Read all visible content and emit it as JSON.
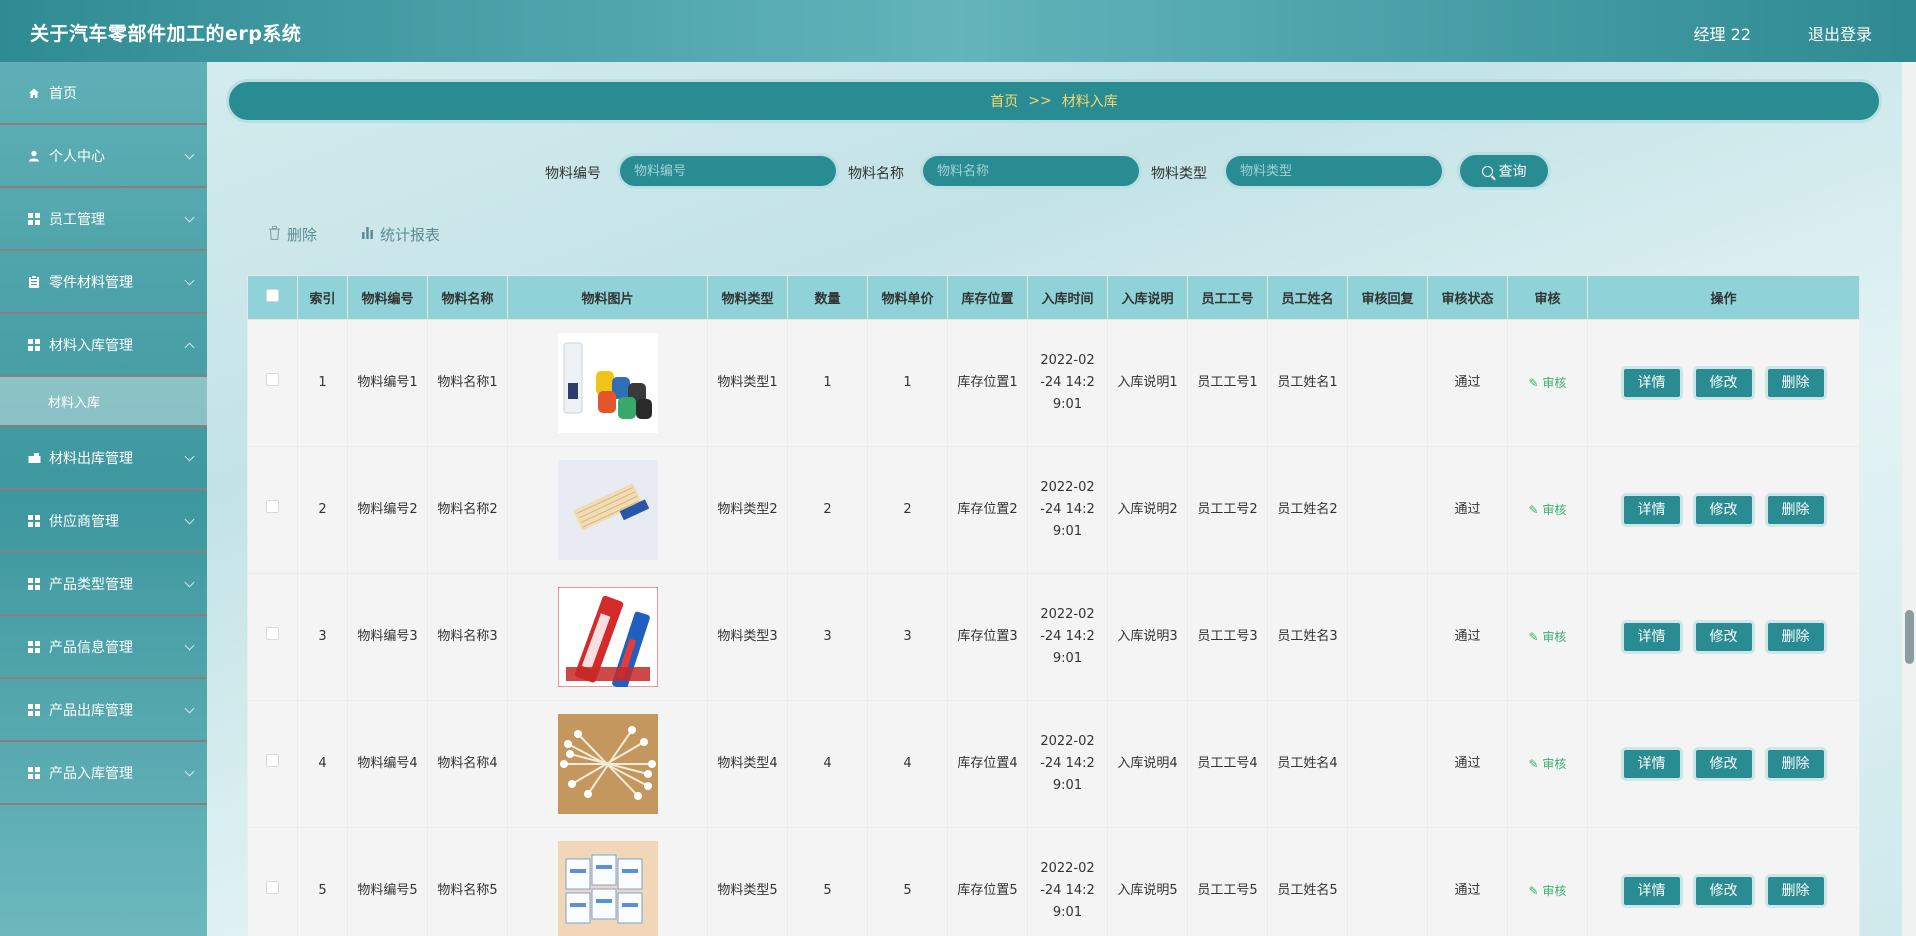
{
  "app": {
    "title": "关于汽车零部件加工的erp系统",
    "user": "经理 22",
    "logout": "退出登录"
  },
  "sidebar": {
    "items": [
      {
        "label": "首页",
        "icon": "home-icon"
      },
      {
        "label": "个人中心",
        "icon": "user-icon"
      },
      {
        "label": "员工管理",
        "icon": "grid-icon"
      },
      {
        "label": "零件材料管理",
        "icon": "clipboard-icon"
      },
      {
        "label": "材料入库管理",
        "icon": "grid-icon"
      },
      {
        "label": "材料出库管理",
        "icon": "truck-icon"
      },
      {
        "label": "供应商管理",
        "icon": "grid-icon"
      },
      {
        "label": "产品类型管理",
        "icon": "grid-icon"
      },
      {
        "label": "产品信息管理",
        "icon": "grid-icon"
      },
      {
        "label": "产品出库管理",
        "icon": "grid-icon"
      },
      {
        "label": "产品入库管理",
        "icon": "grid-icon"
      }
    ],
    "active_sub": "材料入库"
  },
  "breadcrumb": {
    "home": "首页",
    "sep": ">>",
    "current": "材料入库"
  },
  "search": {
    "code_label": "物料编号",
    "code_placeholder": "物料编号",
    "name_label": "物料名称",
    "name_placeholder": "物料名称",
    "type_label": "物料类型",
    "type_placeholder": "物料类型",
    "button": "查询"
  },
  "actions": {
    "delete": "删除",
    "report": "统计报表"
  },
  "table": {
    "headers": [
      "索引",
      "物料编号",
      "物料名称",
      "物料图片",
      "物料类型",
      "数量",
      "物料单价",
      "库存位置",
      "入库时间",
      "入库说明",
      "员工工号",
      "员工姓名",
      "审核回复",
      "审核状态",
      "审核",
      "操作"
    ],
    "rows": [
      {
        "index": "1",
        "code": "物料编号1",
        "name": "物料名称1",
        "type": "物料类型1",
        "qty": "1",
        "price": "1",
        "location": "库存位置1",
        "time": "2022-02-24 14:29:01",
        "note": "入库说明1",
        "emp_no": "员工工号1",
        "emp_name": "员工姓名1",
        "reply": "",
        "status": "通过",
        "image": "trash-bags-photo"
      },
      {
        "index": "2",
        "code": "物料编号2",
        "name": "物料名称2",
        "type": "物料类型2",
        "qty": "2",
        "price": "2",
        "location": "库存位置2",
        "time": "2022-02-24 14:29:01",
        "note": "入库说明2",
        "emp_no": "员工工号2",
        "emp_name": "员工姓名2",
        "reply": "",
        "status": "通过",
        "image": "toothpicks-photo"
      },
      {
        "index": "3",
        "code": "物料编号3",
        "name": "物料名称3",
        "type": "物料类型3",
        "qty": "3",
        "price": "3",
        "location": "库存位置3",
        "time": "2022-02-24 14:29:01",
        "note": "入库说明3",
        "emp_no": "员工工号3",
        "emp_name": "员工姓名3",
        "reply": "",
        "status": "通过",
        "image": "toothpaste-photo"
      },
      {
        "index": "4",
        "code": "物料编号4",
        "name": "物料名称4",
        "type": "物料类型4",
        "qty": "4",
        "price": "4",
        "location": "库存位置4",
        "time": "2022-02-24 14:29:01",
        "note": "入库说明4",
        "emp_no": "员工工号4",
        "emp_name": "员工姓名4",
        "reply": "",
        "status": "通过",
        "image": "cotton-swabs-photo"
      },
      {
        "index": "5",
        "code": "物料编号5",
        "name": "物料名称5",
        "type": "物料类型5",
        "qty": "5",
        "price": "5",
        "location": "库存位置5",
        "time": "2022-02-24 14:29:01",
        "note": "入库说明5",
        "emp_no": "员工工号5",
        "emp_name": "员工姓名5",
        "reply": "",
        "status": "通过",
        "image": "tissue-packs-photo"
      }
    ],
    "audit_label": "审核",
    "op": {
      "detail": "详情",
      "edit": "修改",
      "delete": "删除"
    }
  },
  "colors": {
    "accent": "#288c92",
    "header_row": "#8fd3d8",
    "breadcrumb_text": "#f5d86a",
    "audit_link": "#3dae73"
  }
}
